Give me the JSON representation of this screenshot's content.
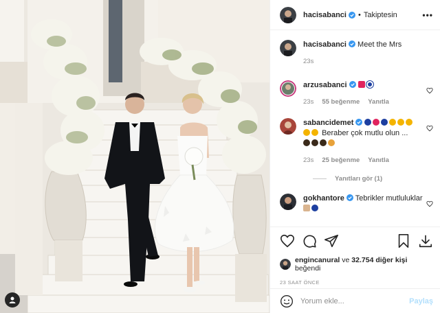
{
  "post": {
    "author": "hacisabanci",
    "follow_status": "Takiptesin",
    "more_label": "•••",
    "caption": "Meet the Mrs",
    "caption_time": "23s"
  },
  "comments": [
    {
      "user": "arzusabanci",
      "time": "23s",
      "likes": "55 beğenme",
      "reply": "Yanıtla"
    },
    {
      "user": "sabancidemet",
      "text": "Beraber çok mutlu olun ...",
      "time": "23s",
      "likes": "25 beğenme",
      "reply": "Yanıtla",
      "view_replies": "Yanıtları gör (1)"
    },
    {
      "user": "gokhantore",
      "text": "Tebrikler mutluluklar"
    }
  ],
  "engagement": {
    "liker": "engincanural",
    "connector": "ve",
    "others": "32.754 diğer kişi",
    "suffix": "beğendi",
    "time": "23 SAAT ÖNCE"
  },
  "composer": {
    "placeholder": "Yorum ekle...",
    "post_label": "Paylaş"
  },
  "colors": {
    "verified": "#3897f0",
    "secondary_text": "#8e8e8e",
    "post_button_disabled": "#b2dffc"
  },
  "icons": [
    "heart-icon",
    "comment-icon",
    "share-icon",
    "bookmark-icon",
    "download-icon",
    "emoji-icon",
    "verified-icon",
    "user-icon"
  ]
}
